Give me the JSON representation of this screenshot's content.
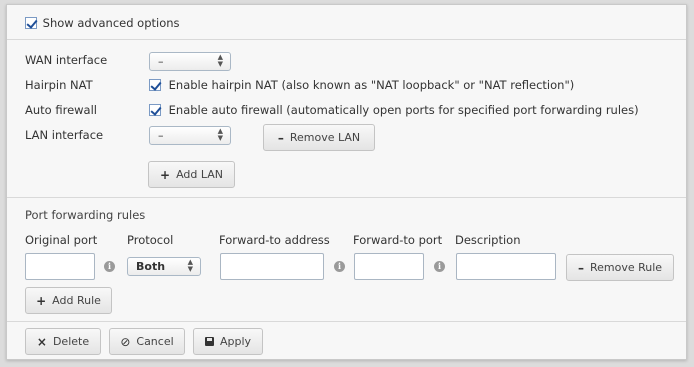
{
  "advanced": {
    "label": "Show advanced options",
    "checked": true
  },
  "wan": {
    "label": "WAN interface",
    "value": "–"
  },
  "hairpin": {
    "label": "Hairpin NAT",
    "checkbox_label": "Enable hairpin NAT (also known as \"NAT loopback\" or \"NAT reflection\")",
    "checked": true
  },
  "firewall": {
    "label": "Auto firewall",
    "checkbox_label": "Enable auto firewall (automatically open ports for specified port forwarding rules)",
    "checked": true
  },
  "lan": {
    "label": "LAN interface",
    "value": "–",
    "remove_label": "Remove LAN",
    "add_label": "Add LAN"
  },
  "port_forwarding": {
    "title": "Port forwarding rules",
    "columns": [
      "Original port",
      "Protocol",
      "Forward-to address",
      "Forward-to port",
      "Description"
    ],
    "rule": {
      "original_port": "",
      "protocol": "Both",
      "forward_address": "",
      "forward_port": "",
      "description": ""
    },
    "remove_rule_label": "Remove Rule",
    "add_rule_label": "Add Rule"
  },
  "actions": {
    "delete_label": "Delete",
    "cancel_label": "Cancel",
    "apply_label": "Apply"
  },
  "icons": {
    "info": "i",
    "plus": "+",
    "minus": "–",
    "delete": "×",
    "cancel": "⊘"
  }
}
